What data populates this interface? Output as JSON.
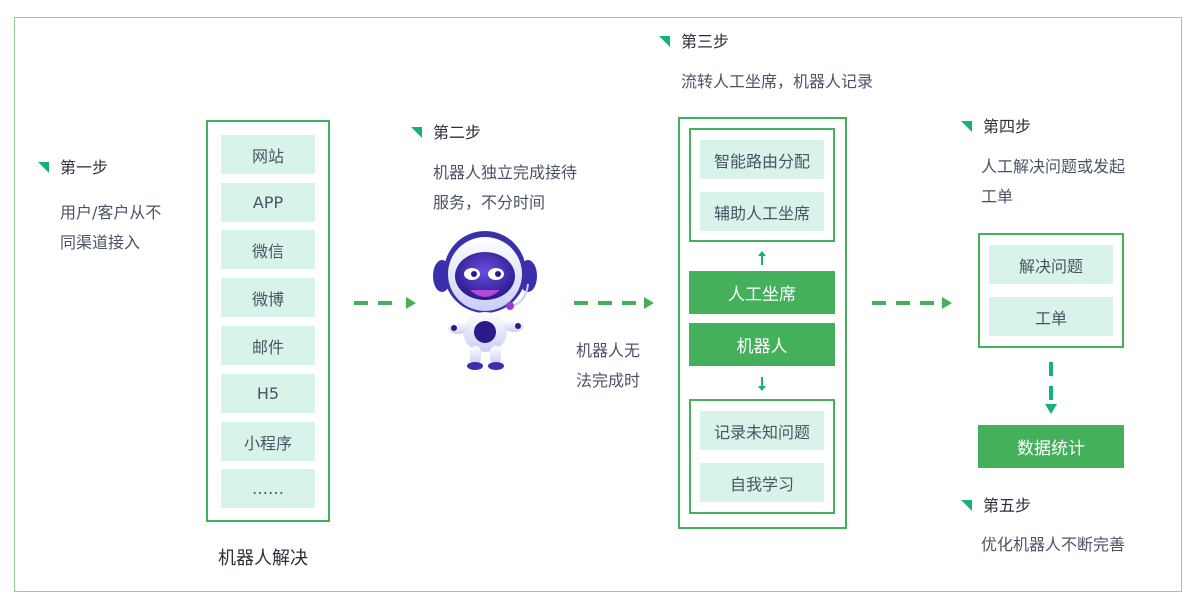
{
  "colors": {
    "frame": "#8fd19a",
    "accent_green": "#45b05c",
    "teal_marker": "#19b07a",
    "tile_bg": "#d8f4ea",
    "text": "#4a5366",
    "title_text": "#2b2f3a"
  },
  "step1": {
    "title": "第一步",
    "desc_lines": [
      "用户/客户从不",
      "同渠道接入"
    ]
  },
  "channels": {
    "items": [
      "网站",
      "APP",
      "微信",
      "微博",
      "邮件",
      "H5",
      "小程序",
      "……"
    ],
    "caption": "机器人解决"
  },
  "step2": {
    "title": "第二步",
    "desc_lines": [
      "机器人独立完成接待",
      "服务，不分时间"
    ],
    "robot_icon": "robot-mascot-icon"
  },
  "transfer_note": {
    "lines": [
      "机器人无",
      "法完成时"
    ]
  },
  "step3": {
    "title": "第三步",
    "desc": "流转人工坐席，机器人记录",
    "upper_tiles": [
      "智能路由分配",
      "辅助人工坐席"
    ],
    "agent_label": "人工坐席",
    "robot_label": "机器人",
    "lower_tiles": [
      "记录未知问题",
      "自我学习"
    ]
  },
  "step4": {
    "title": "第四步",
    "desc_lines": [
      "人工解决问题或发起",
      "工单"
    ],
    "tiles": [
      "解决问题",
      "工单"
    ]
  },
  "stats": {
    "label": "数据统计"
  },
  "step5": {
    "title": "第五步",
    "desc": "优化机器人不断完善"
  }
}
